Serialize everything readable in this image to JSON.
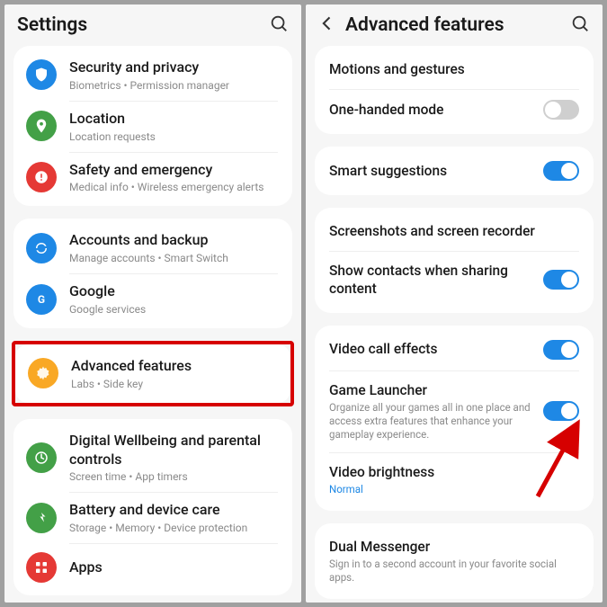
{
  "left": {
    "title": "Settings",
    "groups": [
      [
        {
          "icon": "shield",
          "color": "#1e88e5",
          "title": "Security and privacy",
          "sub": "Biometrics  •  Permission manager"
        },
        {
          "icon": "pin",
          "color": "#43a047",
          "title": "Location",
          "sub": "Location requests"
        },
        {
          "icon": "alert",
          "color": "#e53935",
          "title": "Safety and emergency",
          "sub": "Medical info  •  Wireless emergency alerts"
        }
      ],
      [
        {
          "icon": "sync",
          "color": "#1e88e5",
          "title": "Accounts and backup",
          "sub": "Manage accounts  •  Smart Switch"
        },
        {
          "icon": "google",
          "color": "#1e88e5",
          "title": "Google",
          "sub": "Google services"
        }
      ]
    ],
    "highlighted": {
      "icon": "gear",
      "color": "#f9a825",
      "title": "Advanced features",
      "sub": "Labs  •  Side key"
    },
    "bottom": [
      {
        "icon": "wellbeing",
        "color": "#43a047",
        "title": "Digital Wellbeing and parental controls",
        "sub": "Screen time  •  App timers"
      },
      {
        "icon": "battery",
        "color": "#43a047",
        "title": "Battery and device care",
        "sub": "Storage  •  Memory  •  Device protection"
      },
      {
        "icon": "apps",
        "color": "#e53935",
        "title": "Apps",
        "sub": ""
      }
    ]
  },
  "right": {
    "title": "Advanced features",
    "groups": [
      [
        {
          "title": "Motions and gestures"
        },
        {
          "title": "One-handed mode",
          "toggle": false
        }
      ],
      [
        {
          "title": "Smart suggestions",
          "toggle": true
        }
      ],
      [
        {
          "title": "Screenshots and screen recorder"
        },
        {
          "title": "Show contacts when sharing content",
          "toggle": true
        }
      ],
      [
        {
          "title": "Video call effects",
          "toggle": true
        },
        {
          "title": "Game Launcher",
          "sub": "Organize all your games all in one place and access extra features that enhance your gameplay experience.",
          "toggle": true
        },
        {
          "title": "Video brightness",
          "sub": "Normal",
          "subBlue": true
        }
      ],
      [
        {
          "title": "Dual Messenger",
          "sub": "Sign in to a second account in your favorite social apps."
        }
      ]
    ]
  }
}
